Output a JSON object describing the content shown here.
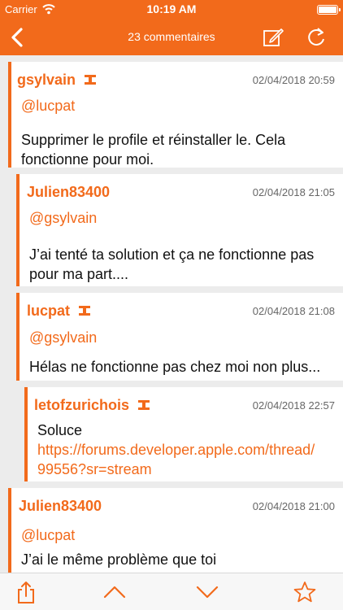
{
  "status_bar": {
    "carrier": "Carrier",
    "time": "10:19 AM"
  },
  "nav_bar": {
    "title": "23 commentaires"
  },
  "comments": [
    {
      "author": "gsylvain",
      "date": "02/04/2018 20:59",
      "mention": "@lucpat",
      "body_line1": "Supprimer le profile et réinstaller le. Cela",
      "body_line2": "fonctionne pour moi."
    },
    {
      "author": "Julien83400",
      "date": "02/04/2018 21:05",
      "mention": "@gsylvain",
      "body_line1": "J’ai tenté ta solution et ça ne fonctionne pas",
      "body_line2": "pour ma part...."
    },
    {
      "author": "lucpat",
      "date": "02/04/2018 21:08",
      "mention": "@gsylvain",
      "body_line1": "Hélas ne fonctionne pas chez moi non plus..."
    },
    {
      "author": "letofzurichois",
      "date": "02/04/2018 22:57",
      "body_line1": "Soluce",
      "link_line1": "https://forums.developer.apple.com/thread/",
      "link_line2": "99556?sr=stream"
    },
    {
      "author": "Julien83400",
      "date": "02/04/2018 21:00",
      "mention": "@lucpat",
      "body_line1": "J’ai le même problème que toi"
    }
  ],
  "colors": {
    "accent": "#f26a1b",
    "background": "#ececec"
  },
  "icons": {
    "back": "chevron-left-icon",
    "compose": "compose-icon",
    "refresh": "refresh-icon",
    "badge": "moderator-badge-icon",
    "share": "share-icon",
    "up": "chevron-up-icon",
    "down": "chevron-down-icon",
    "favorite": "star-icon"
  }
}
